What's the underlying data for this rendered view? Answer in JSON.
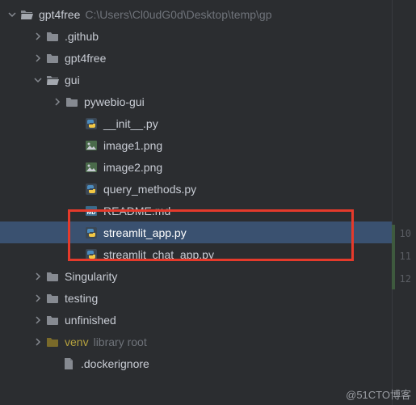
{
  "root": {
    "name": "gpt4free",
    "path": "C:\\Users\\Cl0udG0d\\Desktop\\temp\\gp"
  },
  "nodes": [
    {
      "label": ".github"
    },
    {
      "label": "gpt4free"
    },
    {
      "label": "gui"
    },
    {
      "label": "pywebio-gui"
    },
    {
      "label": "__init__.py"
    },
    {
      "label": "image1.png"
    },
    {
      "label": "image2.png"
    },
    {
      "label": "query_methods.py"
    },
    {
      "label": "README.md"
    },
    {
      "label": "streamlit_app.py"
    },
    {
      "label": "streamlit_chat_app.py"
    },
    {
      "label": "Singularity"
    },
    {
      "label": "testing"
    },
    {
      "label": "unfinished"
    },
    {
      "label": "venv",
      "hint": "library root"
    },
    {
      "label": ".dockerignore"
    }
  ],
  "gutter": {
    "lines": [
      "10",
      "11",
      "12"
    ]
  },
  "watermark": "@51CTO博客"
}
